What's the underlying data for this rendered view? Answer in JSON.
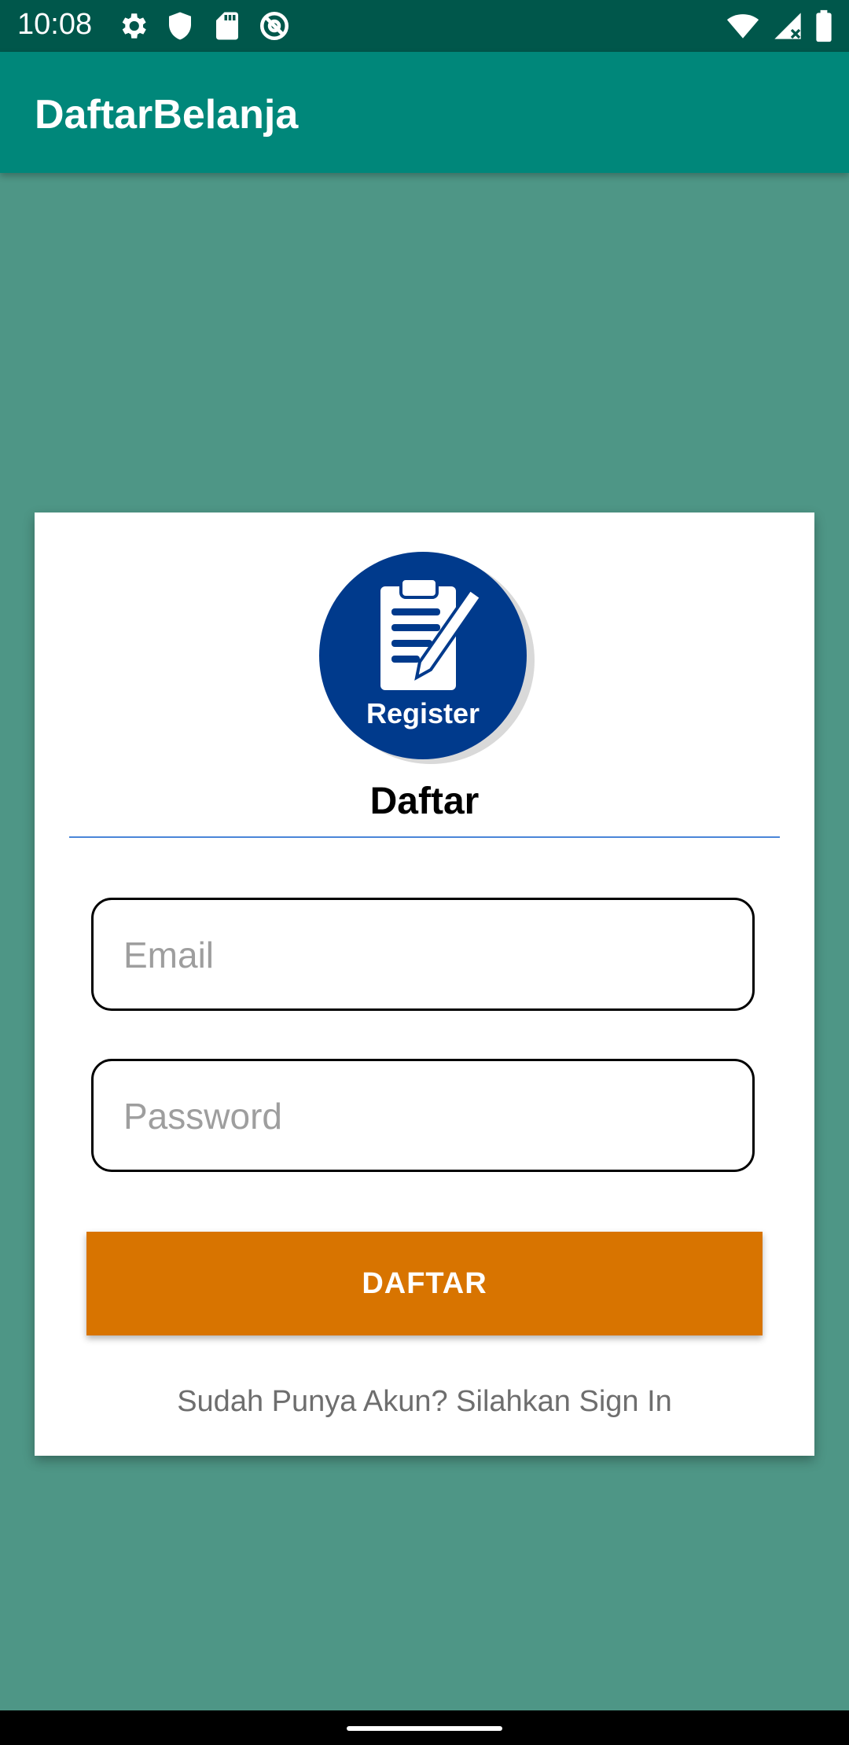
{
  "status_bar": {
    "time": "10:08",
    "icons_left": [
      "settings-icon",
      "shield-icon",
      "sd-card-icon",
      "at-sign-icon"
    ],
    "icons_right": [
      "wifi-icon",
      "signal-icon",
      "battery-icon"
    ]
  },
  "app_bar": {
    "title": "DaftarBelanja"
  },
  "card": {
    "logo_text": "Register",
    "title": "Daftar",
    "email_placeholder": "Email",
    "password_placeholder": "Password",
    "submit_label": "DAFTAR",
    "signin_text": "Sudah Punya Akun? Silahkan Sign In"
  },
  "colors": {
    "background": "#4e9686",
    "app_bar": "#00877a",
    "status_bar": "#00574b",
    "button": "#d87400",
    "logo_circle": "#003a8c",
    "divider": "#4a86d8"
  }
}
